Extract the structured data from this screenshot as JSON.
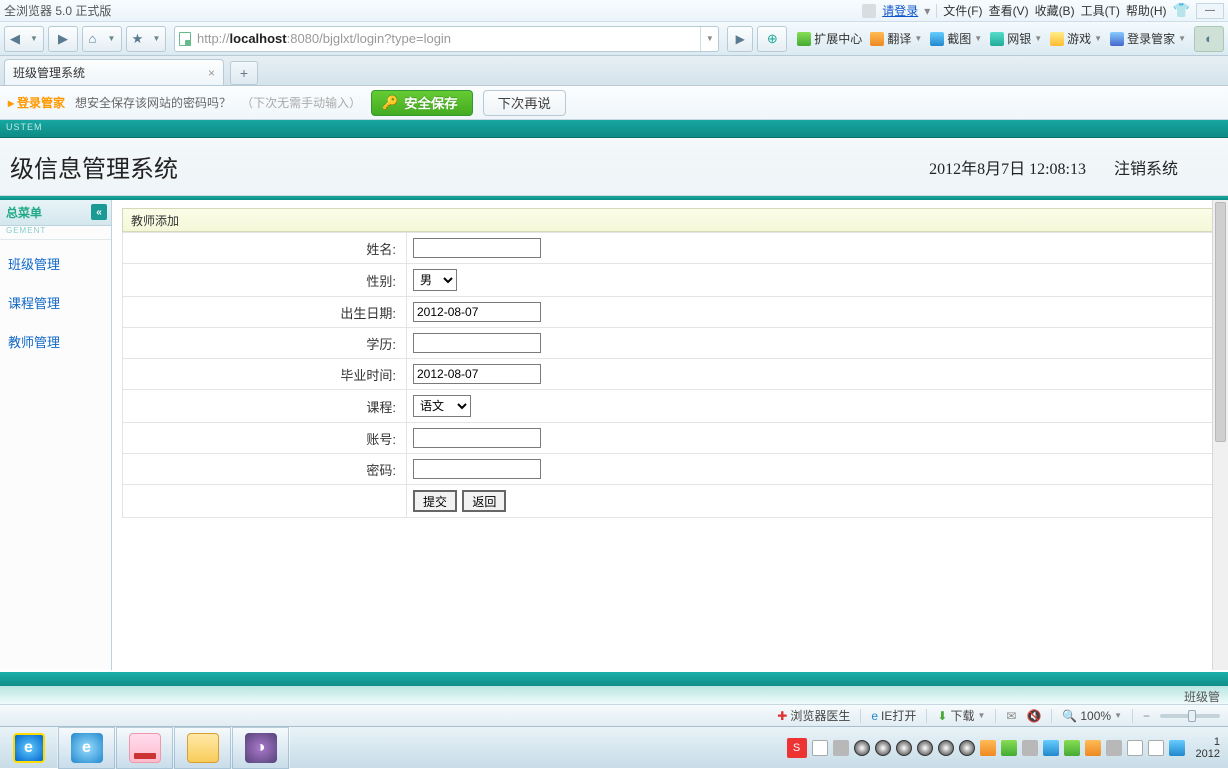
{
  "titlebar": {
    "app_name": "全浏览器 5.0 正式版",
    "login_label": "请登录",
    "menus": [
      "文件(F)",
      "查看(V)",
      "收藏(B)",
      "工具(T)",
      "帮助(H)"
    ]
  },
  "navbar": {
    "url_plain_pre": "http://",
    "url_bold": "localhost",
    "url_plain_post": ":8080/bjglxt/login?type=login",
    "extras": {
      "extend_center": "扩展中心",
      "translate": "翻译",
      "screenshot": "截图",
      "netbank": "网银",
      "games": "游戏",
      "login_mgr": "登录管家"
    }
  },
  "tabstrip": {
    "tab0_label": "班级管理系统"
  },
  "pwbar": {
    "lead": "登录管家",
    "question": "想安全保存该网站的密码吗？",
    "hint": "（下次无需手动输入）",
    "save_btn": "安全保存",
    "later_btn": "下次再说"
  },
  "tealband": {
    "text": "USTEM"
  },
  "pagehdr": {
    "title": "级信息管理系统",
    "datetime": "2012年8月7日  12:08:13",
    "logout": "注销系统"
  },
  "sidebar": {
    "header": "总菜单",
    "sub": "GEMENT",
    "items": [
      "班级管理",
      "课程管理",
      "教师管理"
    ]
  },
  "panel": {
    "title": "教师添加",
    "fields": {
      "name_lbl": "姓名:",
      "gender_lbl": "性别:",
      "gender_val": "男",
      "birth_lbl": "出生日期:",
      "birth_val": "2012-08-07",
      "edu_lbl": "学历:",
      "gradtime_lbl": "毕业时间:",
      "gradtime_val": "2012-08-07",
      "course_lbl": "课程:",
      "course_val": "语文",
      "account_lbl": "账号:",
      "password_lbl": "密码:"
    },
    "buttons": {
      "submit": "提交",
      "back": "返回"
    }
  },
  "footer": {
    "right_text": "班级管"
  },
  "statusbar": {
    "doctor": "浏览器医生",
    "ieopen": "IE打开",
    "download": "下载",
    "zoom": "100%"
  },
  "taskbar": {
    "lang": "S",
    "clock_line1": "1",
    "clock_line2": "2012"
  }
}
